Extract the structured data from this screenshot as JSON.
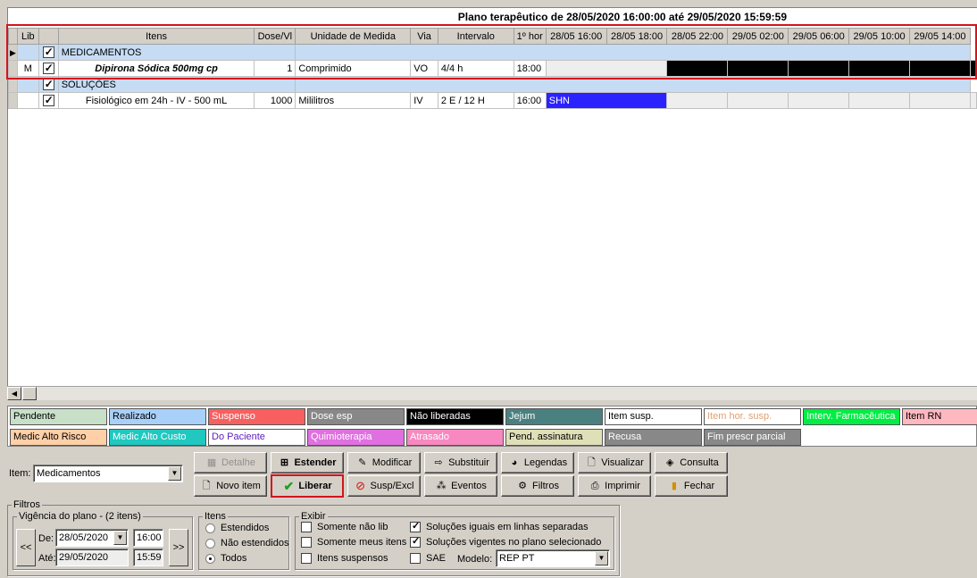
{
  "plan_title": "Plano terapêutico de 28/05/2020 16:00:00 até 29/05/2020 15:59:59",
  "columns": [
    "Lib",
    "Itens",
    "Dose/Vl",
    "Unidade de Medida",
    "Via",
    "Intervalo",
    "1º hor",
    "28/05 16:00",
    "28/05 18:00",
    "28/05 22:00",
    "29/05 02:00",
    "29/05 06:00",
    "29/05 10:00",
    "29/05 14:00"
  ],
  "rows": [
    {
      "type": "group",
      "label": "MEDICAMENTOS"
    },
    {
      "type": "item",
      "lib": "M",
      "item": "Dipirona Sódica 500mg cp",
      "dose": "1",
      "unit": "Comprimido",
      "via": "VO",
      "interval": "4/4 h",
      "first": "18:00",
      "first_cell": ""
    },
    {
      "type": "group",
      "label": "SOLUÇÕES"
    },
    {
      "type": "item",
      "lib": "",
      "item": "Fisiológico em 24h - IV - 500 mL",
      "dose": "1000",
      "unit": "Mililitros",
      "via": "IV",
      "interval": "2 E / 12 H",
      "first": "16:00",
      "first_cell": "SHN"
    }
  ],
  "legend": [
    {
      "label": "Pendente",
      "bg": "#c8e0c8",
      "fg": "#000"
    },
    {
      "label": "Realizado",
      "bg": "#a8d0f8",
      "fg": "#000"
    },
    {
      "label": "Suspenso",
      "bg": "#f86060",
      "fg": "#fff"
    },
    {
      "label": "Dose esp",
      "bg": "#888888",
      "fg": "#fff"
    },
    {
      "label": "Não liberadas",
      "bg": "#000000",
      "fg": "#fff"
    },
    {
      "label": "Jejum",
      "bg": "#4a8080",
      "fg": "#fff"
    },
    {
      "label": "Item susp.",
      "bg": "#ffffff",
      "fg": "#000"
    },
    {
      "label": "Item hor. susp.",
      "bg": "#ffffff",
      "fg": "#e0a070"
    },
    {
      "label": "Interv. Farmacêutica",
      "bg": "#00ee44",
      "fg": "#fff"
    },
    {
      "label": "Item RN",
      "bg": "#ffb8c0",
      "fg": "#000"
    },
    {
      "label": "Medic Alto Risco",
      "bg": "#ffd0a8",
      "fg": "#000"
    },
    {
      "label": "Medic Alto Custo",
      "bg": "#20c8c0",
      "fg": "#fff"
    },
    {
      "label": "Do Paciente",
      "bg": "#ffffff",
      "fg": "#6020c0"
    },
    {
      "label": "Quimioterapia",
      "bg": "#e070e0",
      "fg": "#fff"
    },
    {
      "label": "Atrasado",
      "bg": "#f888c0",
      "fg": "#fff"
    },
    {
      "label": "Pend. assinatura",
      "bg": "#e0e0b8",
      "fg": "#000"
    },
    {
      "label": "Recusa",
      "bg": "#888888",
      "fg": "#fff"
    },
    {
      "label": "Fim prescr parcial",
      "bg": "#888888",
      "fg": "#fff"
    }
  ],
  "item_select": {
    "label": "Item:",
    "value": "Medicamentos"
  },
  "buttons": {
    "detalhe": "Detalhe",
    "estender": "Estender",
    "modificar": "Modificar",
    "substituir": "Substituir",
    "legendas": "Legendas",
    "visualizar": "Visualizar",
    "consulta": "Consulta",
    "novo_item": "Novo item",
    "liberar": "Liberar",
    "susp_excl": "Susp/Excl",
    "eventos": "Eventos",
    "filtros": "Filtros",
    "imprimir": "Imprimir",
    "fechar": "Fechar"
  },
  "filters": {
    "title": "Filtros",
    "vigencia": {
      "title": "Vigência do plano - (2 itens)",
      "de_label": "De:",
      "de_date": "28/05/2020",
      "de_time": "16:00",
      "ate_label": "Até:",
      "ate_date": "29/05/2020",
      "ate_time": "15:59",
      "prev": "<<",
      "next": ">>"
    },
    "itens": {
      "title": "Itens",
      "options": [
        "Estendidos",
        "Não estendidos",
        "Todos"
      ],
      "selected": 2
    },
    "exibir": {
      "title": "Exibir",
      "left": [
        {
          "label": "Somente não lib",
          "checked": false
        },
        {
          "label": "Somente meus itens",
          "checked": false
        },
        {
          "label": "Itens suspensos",
          "checked": false
        }
      ],
      "right": [
        {
          "label": "Soluções iguais em linhas separadas",
          "checked": true
        },
        {
          "label": "Soluções vigentes no plano selecionado",
          "checked": true
        },
        {
          "label": "SAE",
          "checked": false
        }
      ],
      "modelo_label": "Modelo:",
      "modelo_value": "REP PT"
    }
  }
}
